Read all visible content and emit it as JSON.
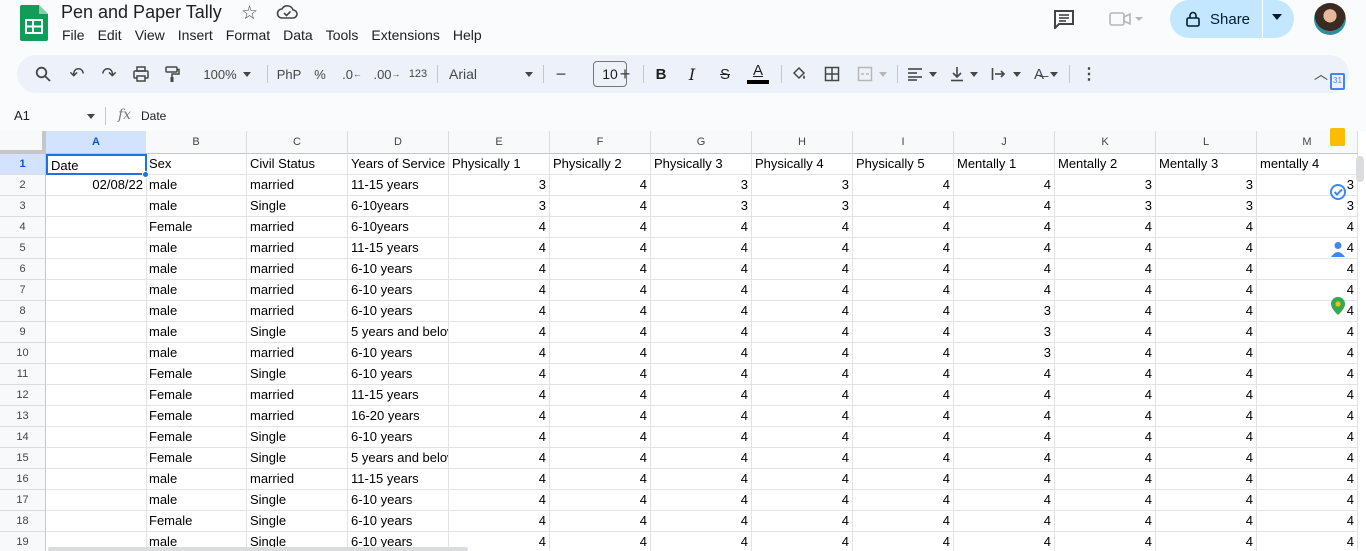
{
  "app": {
    "doc_title": "Pen and Paper Tally",
    "menu": [
      "File",
      "Edit",
      "View",
      "Insert",
      "Format",
      "Data",
      "Tools",
      "Extensions",
      "Help"
    ],
    "share_label": "Share"
  },
  "toolbar": {
    "zoom": "100%",
    "currency": "PhP",
    "percent": "%",
    "dec_decrease": ".0",
    "dec_increase": ".00",
    "number_format": "123",
    "font": "Arial",
    "font_size": "10",
    "bold": "B",
    "italic": "I",
    "strike": "S",
    "text_color": "A"
  },
  "formula_bar": {
    "name_box": "A1",
    "fx": "fx",
    "value": "Date"
  },
  "grid": {
    "columns": [
      "A",
      "B",
      "C",
      "D",
      "E",
      "F",
      "G",
      "H",
      "I",
      "J",
      "K",
      "L",
      "M"
    ],
    "header_row": [
      "Date",
      "Sex",
      "Civil Status",
      "Years of Service",
      "Physically 1",
      "Physically 2",
      "Physically 3",
      "Physically 4",
      "Physically 5",
      "Mentally 1",
      "Mentally 2",
      "Mentally 3",
      "mentally 4"
    ],
    "row_numbers": [
      "1",
      "2",
      "3",
      "4",
      "5",
      "6",
      "7",
      "8",
      "9",
      "10",
      "11",
      "12",
      "13",
      "14",
      "15",
      "16",
      "17",
      "18",
      "19"
    ],
    "rows": [
      [
        "02/08/22",
        "male",
        "married",
        "11-15 years",
        "3",
        "4",
        "3",
        "3",
        "4",
        "4",
        "3",
        "3",
        "3"
      ],
      [
        "",
        "male",
        "Single",
        "6-10years",
        "3",
        "4",
        "3",
        "3",
        "4",
        "4",
        "3",
        "3",
        "3"
      ],
      [
        "",
        "Female",
        "married",
        "6-10years",
        "4",
        "4",
        "4",
        "4",
        "4",
        "4",
        "4",
        "4",
        "4"
      ],
      [
        "",
        "male",
        "married",
        "11-15 years",
        "4",
        "4",
        "4",
        "4",
        "4",
        "4",
        "4",
        "4",
        "4"
      ],
      [
        "",
        "male",
        "married",
        "6-10 years",
        "4",
        "4",
        "4",
        "4",
        "4",
        "4",
        "4",
        "4",
        "4"
      ],
      [
        "",
        "male",
        "married",
        "6-10 years",
        "4",
        "4",
        "4",
        "4",
        "4",
        "4",
        "4",
        "4",
        "4"
      ],
      [
        "",
        "male",
        "married",
        "6-10 years",
        "4",
        "4",
        "4",
        "4",
        "4",
        "3",
        "4",
        "4",
        "4"
      ],
      [
        "",
        "male",
        "Single",
        "5 years and below",
        "4",
        "4",
        "4",
        "4",
        "4",
        "3",
        "4",
        "4",
        "4"
      ],
      [
        "",
        "male",
        "married",
        "6-10 years",
        "4",
        "4",
        "4",
        "4",
        "4",
        "3",
        "4",
        "4",
        "4"
      ],
      [
        "",
        "Female",
        "Single",
        "6-10 years",
        "4",
        "4",
        "4",
        "4",
        "4",
        "4",
        "4",
        "4",
        "4"
      ],
      [
        "",
        "Female",
        "married",
        "11-15 years",
        "4",
        "4",
        "4",
        "4",
        "4",
        "4",
        "4",
        "4",
        "4"
      ],
      [
        "",
        "Female",
        "married",
        "16-20 years",
        "4",
        "4",
        "4",
        "4",
        "4",
        "4",
        "4",
        "4",
        "4"
      ],
      [
        "",
        "Female",
        "Single",
        "6-10 years",
        "4",
        "4",
        "4",
        "4",
        "4",
        "4",
        "4",
        "4",
        "4"
      ],
      [
        "",
        "Female",
        "Single",
        "5 years and below",
        "4",
        "4",
        "4",
        "4",
        "4",
        "4",
        "4",
        "4",
        "4"
      ],
      [
        "",
        "male",
        "married",
        "11-15 years",
        "4",
        "4",
        "4",
        "4",
        "4",
        "4",
        "4",
        "4",
        "4"
      ],
      [
        "",
        "male",
        "Single",
        "6-10 years",
        "4",
        "4",
        "4",
        "4",
        "4",
        "4",
        "4",
        "4",
        "4"
      ],
      [
        "",
        "Female",
        "Single",
        "6-10 years",
        "4",
        "4",
        "4",
        "4",
        "4",
        "4",
        "4",
        "4",
        "4"
      ],
      [
        "",
        "male",
        "Single",
        "6-10 years",
        "4",
        "4",
        "4",
        "4",
        "4",
        "4",
        "4",
        "4",
        "4"
      ]
    ]
  },
  "colors": {
    "accent": "#1a73e8",
    "share_bg": "#c2e7ff",
    "sheets_green": "#0f9d58"
  }
}
